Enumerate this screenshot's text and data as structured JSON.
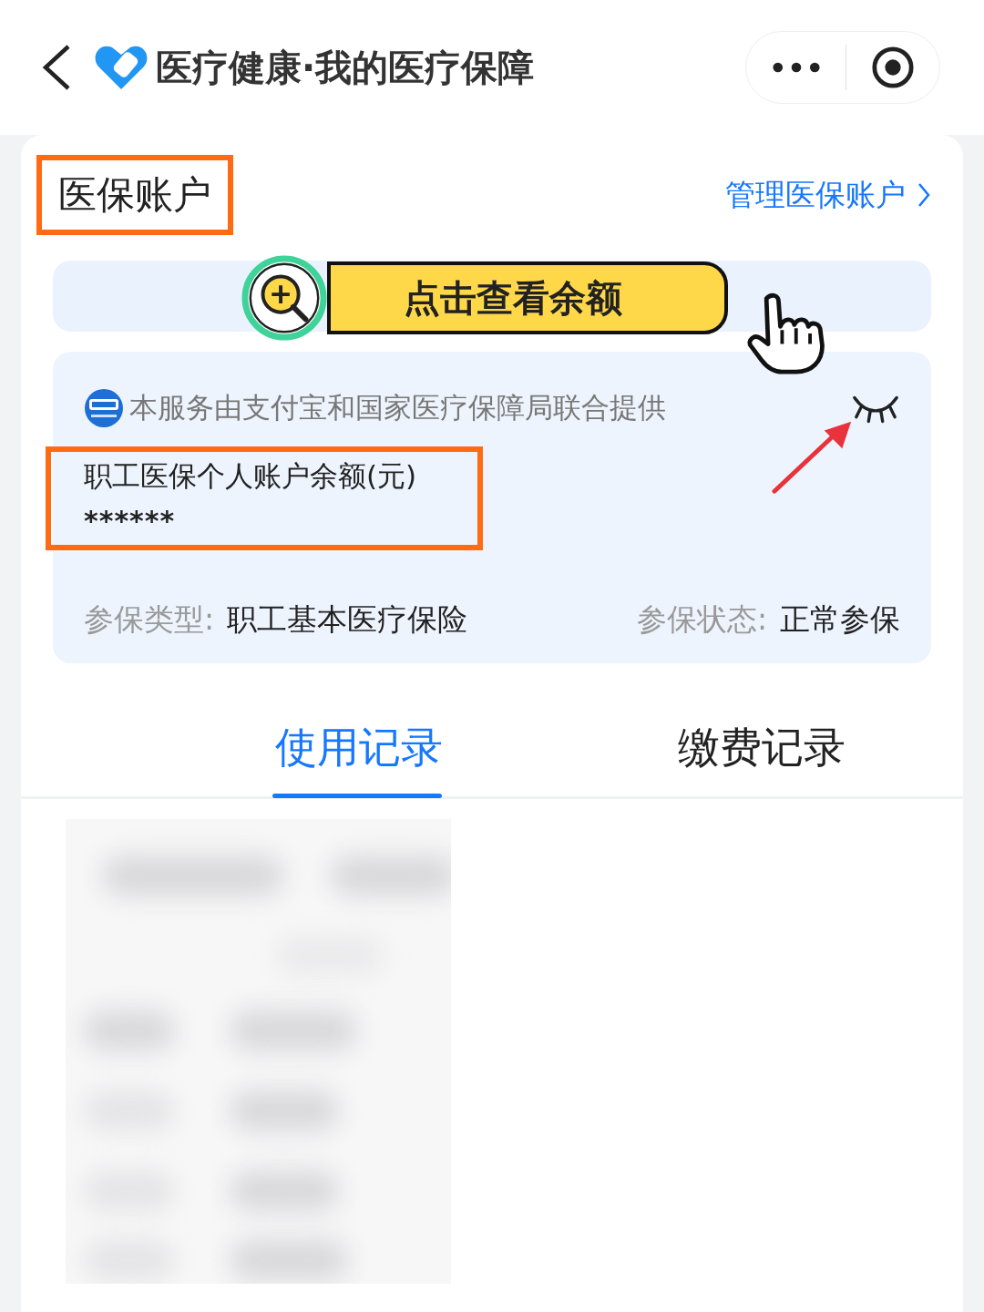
{
  "header": {
    "title": "医疗健康·我的医疗保障"
  },
  "account": {
    "title": "医保账户",
    "manage_link": "管理医保账户",
    "view_balance_button": "点击查看余额",
    "provider_note": "本服务由支付宝和国家医疗保障局联合提供",
    "balance_label": "职工医保个人账户余额(元)",
    "balance_value": "******",
    "balance_hidden": true,
    "details": [
      {
        "label": "参保类型:",
        "value": "职工基本医疗保险"
      },
      {
        "label": "参保状态:",
        "value": "正常参保"
      }
    ]
  },
  "tabs": [
    {
      "label": "使用记录",
      "selected": true
    },
    {
      "label": "缴费记录",
      "selected": false
    }
  ]
}
